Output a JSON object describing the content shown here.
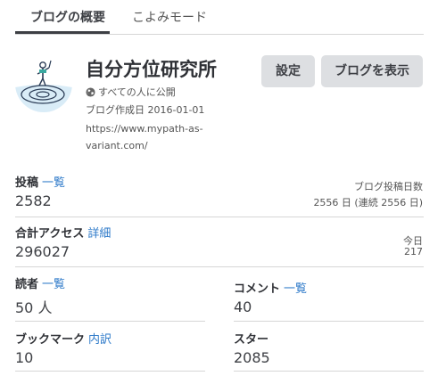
{
  "tabs": [
    {
      "label": "ブログの概要"
    },
    {
      "label": "こよみモード"
    }
  ],
  "blog": {
    "title": "自分方位研究所",
    "visibility": "すべての人に公開",
    "created": "ブログ作成日 2016-01-01",
    "url": "https://www.mypath-as-variant.com/"
  },
  "buttons": {
    "settings": "設定",
    "view_blog": "ブログを表示"
  },
  "stats": {
    "posts": {
      "label": "投稿",
      "link": "一覧",
      "value": "2582"
    },
    "post_days": {
      "label": "ブログ投稿日数",
      "value": "2556 日 (連続 2556 日)"
    },
    "access": {
      "label": "合計アクセス",
      "link": "詳細",
      "value": "296027"
    },
    "today": {
      "label": "今日",
      "value": "217"
    },
    "readers": {
      "label": "読者",
      "link": "一覧",
      "value": "50 人"
    },
    "comments": {
      "label": "コメント",
      "link": "一覧",
      "value": "40"
    },
    "bookmarks": {
      "label": "ブックマーク",
      "link": "内訳",
      "value": "10"
    },
    "stars": {
      "label": "スター",
      "value": "2085"
    }
  },
  "icons": {
    "globe": "globe-icon",
    "avatar": "blog-avatar-image"
  },
  "colors": {
    "link": "#2e7ac9",
    "button_bg": "#dddfe2",
    "text": "#3d3f44"
  }
}
